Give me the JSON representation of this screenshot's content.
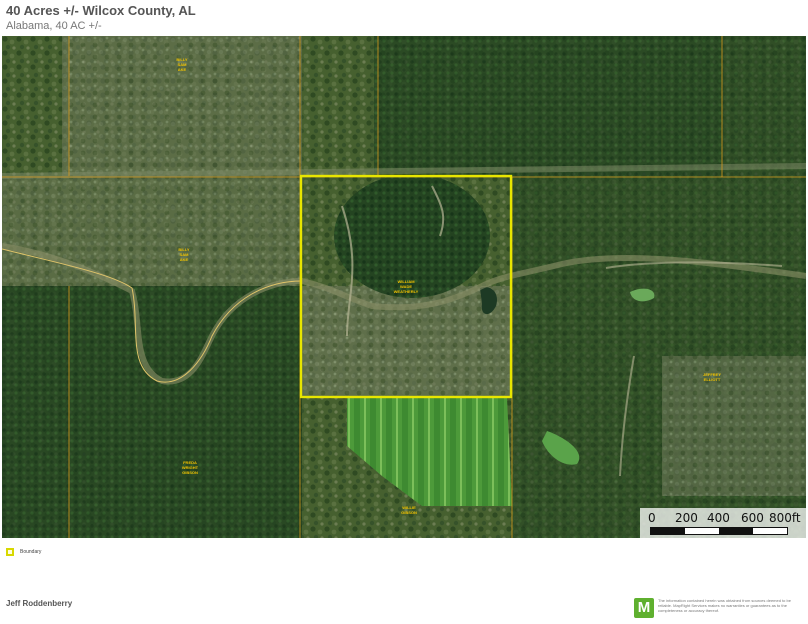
{
  "header": {
    "title": "40 Acres +/- Wilcox County, AL",
    "subtitle": "Alabama, 40 AC +/-"
  },
  "map": {
    "boundary_color": "#e8e600",
    "parcel_line_color": "#d99a1e",
    "owner_label_color": "#f2c200",
    "owners": [
      {
        "label": "BILLY\nSAM\nAKE"
      },
      {
        "label": "BILLY\nSAM\nAKE"
      },
      {
        "label": "WILLIAM\nWADE\nWEATHERLY"
      },
      {
        "label": "JEFFREY\nELLIOTT"
      },
      {
        "label": "FREDA\nWRIGHT\nGIBSON"
      },
      {
        "label": "WILLIE\nGIBSON"
      }
    ]
  },
  "scale_bar": {
    "labels": [
      "0",
      "200",
      "400",
      "600",
      "800ft"
    ]
  },
  "legend": {
    "label": "Boundary"
  },
  "footer": {
    "prepared_by": "Jeff Roddenberry",
    "logo_letter": "M",
    "disclaimer": "The information contained herein was obtained from sources deemed to be reliable. MapRight Services makes no warranties or guarantees as to the completeness or accuracy thereof."
  }
}
